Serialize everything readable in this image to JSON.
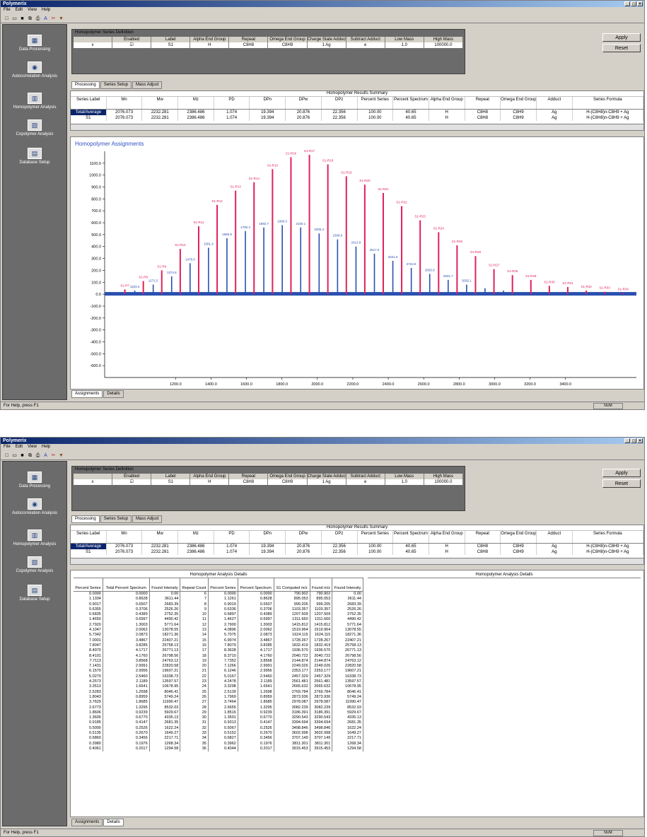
{
  "app": {
    "title": "Polymerix",
    "menu": [
      "File",
      "Edit",
      "View",
      "Help"
    ],
    "status_text": "For Help, press F1",
    "status_right": "NUM",
    "window_buttons": [
      "_",
      "□",
      "×"
    ]
  },
  "toolbar_icons": [
    "new-icon",
    "open-icon",
    "save-icon",
    "copy-icon",
    "print-icon",
    "chart-icon",
    "cut-icon",
    "filter-icon"
  ],
  "sidebar": {
    "items": [
      {
        "label": "Data Processing",
        "icon": "data-processing-icon"
      },
      {
        "label": "Autocorrelation Analysis",
        "icon": "autocorrelation-icon"
      },
      {
        "label": "Homopolymer Analysis",
        "icon": "homopolymer-icon"
      },
      {
        "label": "Copolymer Analysis",
        "icon": "copolymer-icon"
      },
      {
        "label": "Database Setup",
        "icon": "database-icon"
      }
    ]
  },
  "series_def": {
    "title": "Homopolymer Series Definition",
    "headers": [
      "",
      "Enabled",
      "Label",
      "Alpha End Group",
      "Repeat",
      "Omega End Group",
      "Charge State Adduct",
      "Subtract Adduct",
      "Low Mass",
      "High Mass"
    ],
    "row": [
      "x",
      "☑",
      "S1",
      "H",
      "C8H8",
      "C8H9",
      "1 Ag",
      "e",
      "1.0",
      "100000.0"
    ]
  },
  "buttons": {
    "apply": "Apply",
    "reset": "Reset"
  },
  "tabs": [
    "Processing",
    "Series Setup",
    "Mass Adjust"
  ],
  "summary": {
    "title": "Homopolymer Results Summary",
    "headers": [
      "Series Label",
      "Mn",
      "Mw",
      "Mz",
      "PD",
      "DPn",
      "DPw",
      "DPz",
      "Percent Series",
      "Percent Spectrum",
      "Alpha End Group",
      "Repeat",
      "Omega End Group",
      "Adduct",
      "Series Formula"
    ],
    "rows": [
      [
        "Total/Average",
        "2076.073",
        "2232.281",
        "2386.486",
        "1.074",
        "19.394",
        "20.876",
        "22.356",
        "100.00",
        "40.65",
        "H",
        "C8H8",
        "C8H9",
        "Ag",
        "H-(C8H8)n-C8H9 + Ag"
      ],
      [
        "S1",
        "2076.073",
        "2232.281",
        "2386.486",
        "1.074",
        "19.394",
        "20.876",
        "22.356",
        "100.00",
        "40.65",
        "H",
        "C8H8",
        "C8H9",
        "Ag",
        "H-(C8H8)n-C8H9 + Ag"
      ]
    ]
  },
  "bottom_tabs": [
    "Assignments",
    "Details"
  ],
  "chart_data": {
    "type": "bar",
    "title": "Homopolymer Assignments",
    "xlim": [
      800,
      3800
    ],
    "ylim": [
      -700,
      1200
    ],
    "xticks": [
      "1200.0",
      "1400.0",
      "1600.0",
      "1800.0",
      "2000.0",
      "2200.0",
      "2400.0",
      "2600.0",
      "2800.0",
      "3000.0",
      "3200.0",
      "3400.0"
    ],
    "yticks": [
      "1100.0",
      "1000.0",
      "900.0",
      "800.0",
      "700.0",
      "600.0",
      "500.0",
      "400.0",
      "300.0",
      "200.0",
      "100.0",
      "0.0",
      "-100.0",
      "-200.0",
      "-300.0",
      "-400.0",
      "-500.0",
      "-600.0"
    ],
    "series": [
      {
        "name": "assigned",
        "color": "#e0205a",
        "x": [
          914.0,
          1018.1,
          1122.2,
          1226.4,
          1330.5,
          1434.6,
          1538.7,
          1642.8,
          1747.0,
          1851.1,
          1955.2,
          2059.3,
          2163.5,
          2267.6,
          2371.7,
          2475.8,
          2580.0,
          2684.1,
          2788.2,
          2892.3,
          2996.5,
          3100.6,
          3204.7,
          3308.8,
          3412.9,
          3517.1,
          3621.2,
          3725.3
        ],
        "values": [
          40,
          110,
          200,
          380,
          570,
          750,
          870,
          940,
          1050,
          1150,
          1170,
          1090,
          990,
          920,
          850,
          740,
          620,
          520,
          410,
          320,
          210,
          160,
          120,
          70,
          60,
          30,
          20,
          10
        ],
        "labels": [
          "S1-R7",
          "S1-R8",
          "S1-R9",
          "S1-R10",
          "S1-R11",
          "S1-R12",
          "S1-R13",
          "S1-R14",
          "S1-R15",
          "S1-R16",
          "S1-R17",
          "S1-R18",
          "S1-R19",
          "S1-R20",
          "S1-R21",
          "S1-R22",
          "S1-R23",
          "S1-R24",
          "S1-R25",
          "S1-R26",
          "S1-R27",
          "S1-R28",
          "S1-R29",
          "S1-R30",
          "S1-R31",
          "S1-R32",
          "S1-R33",
          "S1-R34"
        ]
      },
      {
        "name": "unassigned",
        "color": "#2a4fb0",
        "x": [
          970,
          1074,
          1178,
          1282,
          1386,
          1490,
          1594,
          1698,
          1802,
          1906,
          2010,
          2114,
          2218,
          2322,
          2426,
          2530,
          2634,
          2738,
          2842,
          2946,
          3050,
          3154
        ],
        "values": [
          30,
          80,
          150,
          260,
          390,
          470,
          530,
          560,
          580,
          560,
          510,
          460,
          400,
          340,
          280,
          220,
          170,
          120,
          80,
          50,
          30,
          15
        ],
        "labels": [
          "1183.4",
          "1271.5",
          "1374.8",
          "1478.0",
          "1581.4",
          "1685.9",
          "1790.3",
          "1892.7",
          "1996.3",
          "2100.1",
          "2205.3",
          "2309.0",
          "2412.8",
          "2517.0",
          "2621.6",
          "2724.8",
          "2826.9",
          "2931.7",
          "3035.1",
          "",
          "",
          ""
        ]
      }
    ]
  },
  "details": {
    "title_left": "Homopolymer Analysis Details",
    "title_right": "Homopolymer Analysis Details",
    "headers": [
      "Percent Series",
      "Total Percent Spectrum",
      "Found Intensity",
      "Repeat Count",
      "Percent Series",
      "Percent Spectrum",
      "S1 Computed m/z",
      "Found m/z",
      "Found Intensity"
    ],
    "rows": [
      [
        "0.0000",
        "0.0000",
        "0.00",
        "6",
        "0.0000",
        "0.0000",
        "790.902",
        "790.902",
        "0.00"
      ],
      [
        "1.1334",
        "0.8628",
        "3611.44",
        "7",
        "1.1261",
        "0.8628",
        "895.053",
        "895.053",
        "3611.44"
      ],
      [
        "0.9017",
        "0.6507",
        "2683.39",
        "8",
        "0.9019",
        "0.6507",
        "999.205",
        "999.205",
        "2683.39"
      ],
      [
        "0.6355",
        "0.3706",
        "2526.26",
        "9",
        "0.6336",
        "0.3706",
        "1103.357",
        "1103.357",
        "2526.26"
      ],
      [
        "0.6835",
        "0.4389",
        "2752.35",
        "10",
        "0.6897",
        "0.4389",
        "1207.509",
        "1207.509",
        "2752.35"
      ],
      [
        "1.4650",
        "0.6997",
        "4490.42",
        "11",
        "1.4627",
        "0.6997",
        "1311.660",
        "1311.660",
        "4490.42"
      ],
      [
        "2.7920",
        "1.3003",
        "5771.64",
        "12",
        "2.7900",
        "1.3003",
        "1415.812",
        "1415.812",
        "5771.64"
      ],
      [
        "4.1047",
        "2.0062",
        "13078.55",
        "13",
        "4.0896",
        "2.0062",
        "1519.964",
        "1519.964",
        "13078.55"
      ],
      [
        "5.7342",
        "2.0873",
        "18271.36",
        "14",
        "5.7075",
        "2.0873",
        "1624.115",
        "1624.115",
        "18271.36"
      ],
      [
        "7.0001",
        "3.4867",
        "22407.21",
        "15",
        "6.9974",
        "3.4867",
        "1728.267",
        "1728.267",
        "22407.21"
      ],
      [
        "7.8047",
        "3.8285",
        "25758.13",
        "16",
        "7.8079",
        "3.8285",
        "1832.419",
        "1832.419",
        "25758.13"
      ],
      [
        "8.4970",
        "4.1717",
        "26771.13",
        "17",
        "8.3628",
        "4.1717",
        "1936.570",
        "1936.570",
        "26771.13"
      ],
      [
        "8.4101",
        "4.1760",
        "26798.56",
        "18",
        "8.3710",
        "4.1760",
        "2040.722",
        "2040.722",
        "26798.56"
      ],
      [
        "7.7113",
        "3.8568",
        "24763.12",
        "19",
        "7.7352",
        "3.8568",
        "2144.874",
        "2144.874",
        "24763.12"
      ],
      [
        "7.1431",
        "2.9991",
        "22820.58",
        "20",
        "7.1266",
        "2.9991",
        "2249.026",
        "2249.026",
        "22820.58"
      ],
      [
        "6.1570",
        "2.9956",
        "19607.21",
        "21",
        "6.1246",
        "2.9956",
        "2353.177",
        "2353.177",
        "19607.21"
      ],
      [
        "5.0270",
        "2.5460",
        "16338.73",
        "22",
        "5.0167",
        "2.5460",
        "2457.329",
        "2457.329",
        "16338.73"
      ],
      [
        "4.2573",
        "2.1189",
        "13597.57",
        "23",
        "4.2478",
        "2.1189",
        "2561.481",
        "2561.481",
        "13597.57"
      ],
      [
        "3.3513",
        "1.6641",
        "10678.95",
        "24",
        "3.3298",
        "1.6641",
        "2665.632",
        "2665.632",
        "10678.95"
      ],
      [
        "2.5283",
        "1.2698",
        "8046.41",
        "25",
        "2.5139",
        "1.2698",
        "2769.784",
        "2769.784",
        "8046.41"
      ],
      [
        "1.8043",
        "0.8959",
        "5749.24",
        "26",
        "1.7969",
        "0.8959",
        "2873.936",
        "2873.936",
        "5749.24"
      ],
      [
        "3.7629",
        "1.8685",
        "11990.47",
        "27",
        "3.7464",
        "1.8685",
        "2978.087",
        "2978.087",
        "11990.47"
      ],
      [
        "2.6773",
        "1.3295",
        "8532.03",
        "28",
        "2.6655",
        "1.3295",
        "3082.239",
        "3082.239",
        "8532.03"
      ],
      [
        "1.8606",
        "0.9239",
        "5929.67",
        "29",
        "1.8516",
        "0.9239",
        "3186.391",
        "3186.391",
        "5929.67"
      ],
      [
        "1.3605",
        "0.6770",
        "4335.13",
        "30",
        "1.3501",
        "0.6770",
        "3290.543",
        "3290.543",
        "4335.13"
      ],
      [
        "0.9185",
        "0.4147",
        "2681.35",
        "31",
        "0.9313",
        "0.4147",
        "3394.694",
        "3394.694",
        "2681.35"
      ],
      [
        "0.5000",
        "0.2526",
        "1622.24",
        "32",
        "0.5067",
        "0.2526",
        "3498.846",
        "3498.846",
        "1622.24"
      ],
      [
        "0.5135",
        "0.2670",
        "1649.27",
        "33",
        "0.5152",
        "0.2670",
        "3602.998",
        "3602.998",
        "1649.27"
      ],
      [
        "0.6860",
        "0.3456",
        "2217.71",
        "34",
        "0.6827",
        "0.3456",
        "3707.149",
        "3707.149",
        "2217.71"
      ],
      [
        "0.3980",
        "0.1976",
        "1268.34",
        "35",
        "0.3962",
        "0.1976",
        "3811.301",
        "3811.301",
        "1268.34"
      ],
      [
        "0.4061",
        "0.2017",
        "1294.58",
        "36",
        "0.4044",
        "0.2017",
        "3915.453",
        "3915.453",
        "1294.58"
      ]
    ]
  }
}
